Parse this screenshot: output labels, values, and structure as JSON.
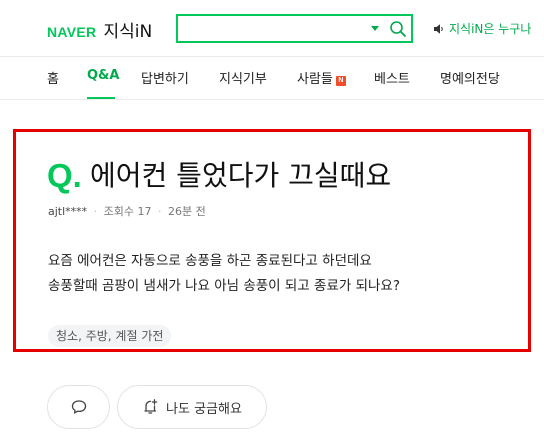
{
  "header": {
    "logo_brand": "NAVER",
    "logo_service": "지식iN",
    "search_placeholder": "",
    "notice": "지식iN은 누구나"
  },
  "nav": {
    "items": [
      "홈",
      "Q&A",
      "답변하기",
      "지식기부",
      "사람들",
      "베스트",
      "명예의전당"
    ],
    "active": "Q&A",
    "badge": "N"
  },
  "question": {
    "q_mark": "Q.",
    "title": "에어컨 틀었다가 끄실때요",
    "author": "ajtl****",
    "views": "조회수 17",
    "time": "26분 전",
    "body": [
      "요즘 에어컨은 자동으로 송풍을 하곤 종료된다고 하던데요",
      "송풍할때 곰팡이 냄새가 나요 아님 송풍이 되고 종료가 되나요?"
    ],
    "tag": "청소, 주방, 계절 가전"
  },
  "actions": {
    "curious_label": "나도 궁금해요"
  },
  "colors": {
    "brand": "#03c75a",
    "highlight_border": "#e60000",
    "badge": "#f04d2a"
  },
  "icons": [
    "caret-down-icon",
    "search-icon",
    "speaker-icon",
    "speech-bubble-icon",
    "bell-plus-icon"
  ]
}
